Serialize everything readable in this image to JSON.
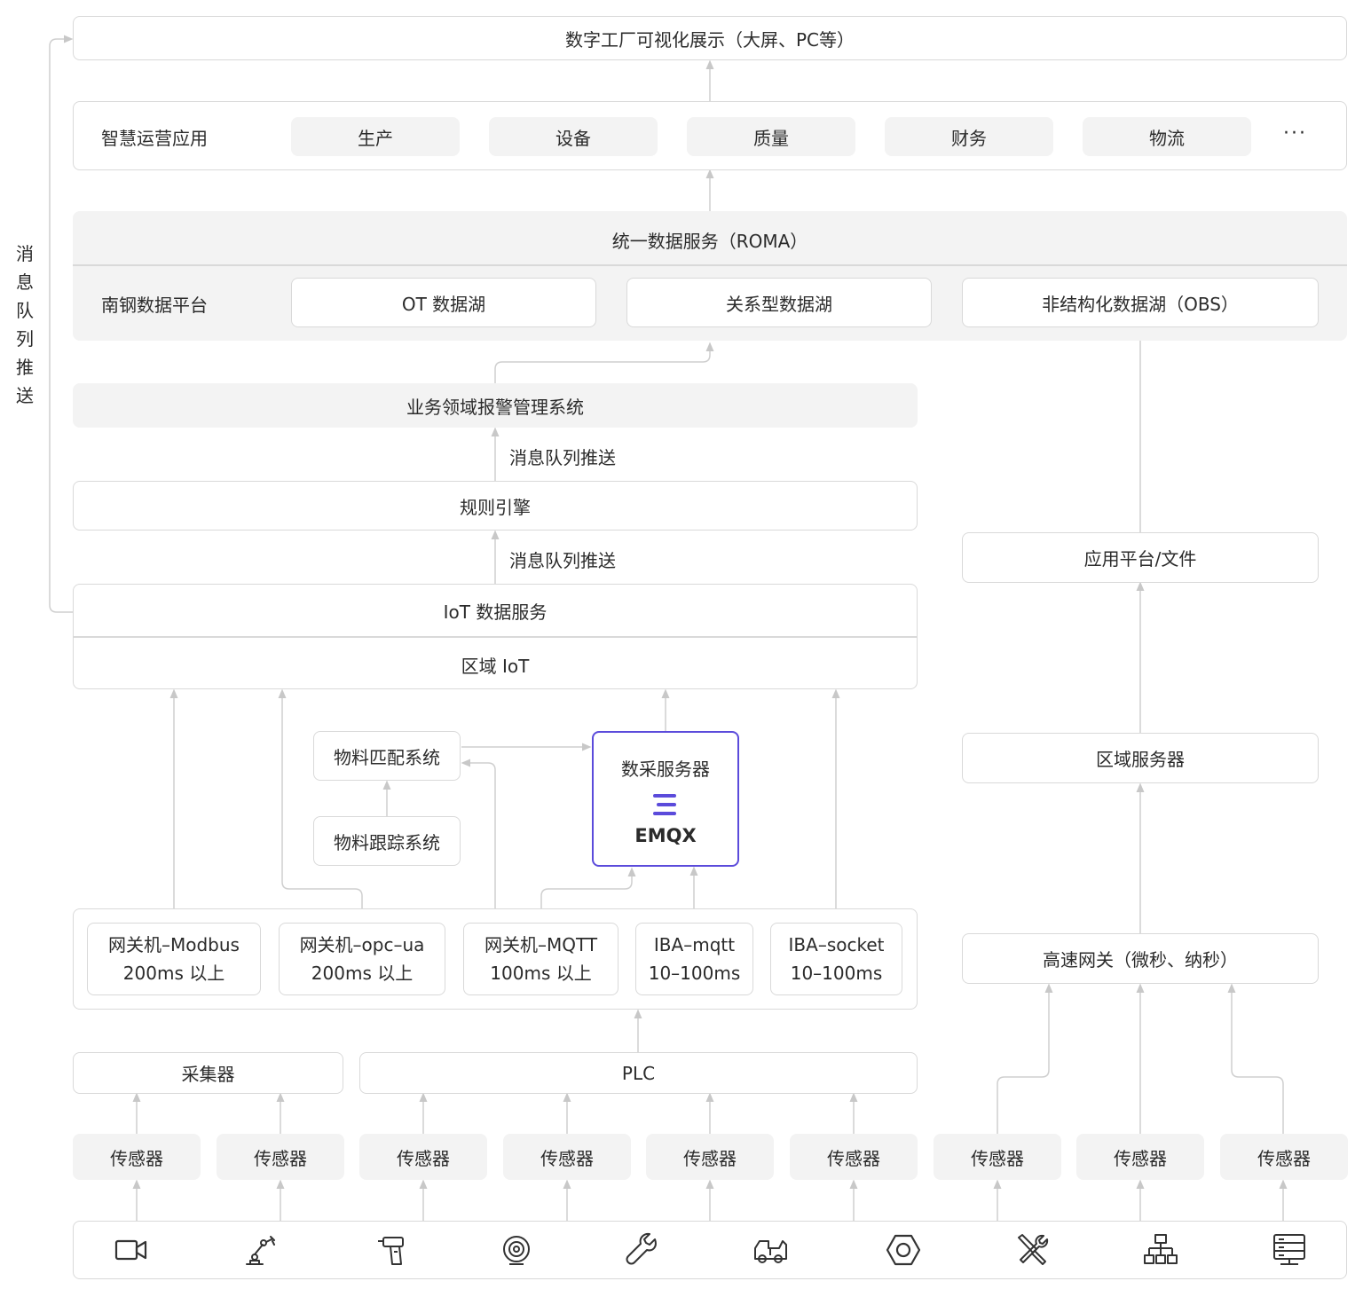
{
  "top_display": "数字工厂可视化展示（大屏、PC等）",
  "smart_apps": {
    "label": "智慧运营应用",
    "items": [
      "生产",
      "设备",
      "质量",
      "财务",
      "物流"
    ],
    "more": "···"
  },
  "unified_service": "统一数据服务（ROMA）",
  "data_platform": {
    "label": "南钢数据平台",
    "items": [
      "OT 数据湖",
      "关系型数据湖",
      "非结构化数据湖（OBS）"
    ]
  },
  "alarm_system": "业务领域报警管理系统",
  "mq_push_1": "消息队列推送",
  "rule_engine": "规则引擎",
  "mq_push_2": "消息队列推送",
  "iot_data_service": "IoT 数据服务",
  "regional_iot": "区域 IoT",
  "side_label": [
    "消",
    "息",
    "队",
    "列",
    "推",
    "送"
  ],
  "material_match": "物料匹配系统",
  "material_track": "物料跟踪系统",
  "data_server": {
    "title": "数采服务器",
    "brand": "EMQX",
    "brand_color": "#5b4bdb"
  },
  "gateways": [
    {
      "line1": "网关机–Modbus",
      "line2": "200ms 以上"
    },
    {
      "line1": "网关机–opc–ua",
      "line2": "200ms 以上"
    },
    {
      "line1": "网关机–MQTT",
      "line2": "100ms 以上"
    },
    {
      "line1": "IBA–mqtt",
      "line2": "10–100ms"
    },
    {
      "line1": "IBA–socket",
      "line2": "10–100ms"
    }
  ],
  "collector": "采集器",
  "plc": "PLC",
  "app_platform": "应用平台/文件",
  "regional_server": "区域服务器",
  "high_speed_gateway": "高速网关（微秒、纳秒）",
  "sensors": [
    "传感器",
    "传感器",
    "传感器",
    "传感器",
    "传感器",
    "传感器",
    "传感器",
    "传感器",
    "传感器"
  ],
  "device_icons": [
    "camera-icon",
    "robot-arm-icon",
    "drill-icon",
    "disc-icon",
    "wrench-icon",
    "truck-icon",
    "hex-nut-icon",
    "tools-icon",
    "network-icon",
    "server-icon"
  ]
}
